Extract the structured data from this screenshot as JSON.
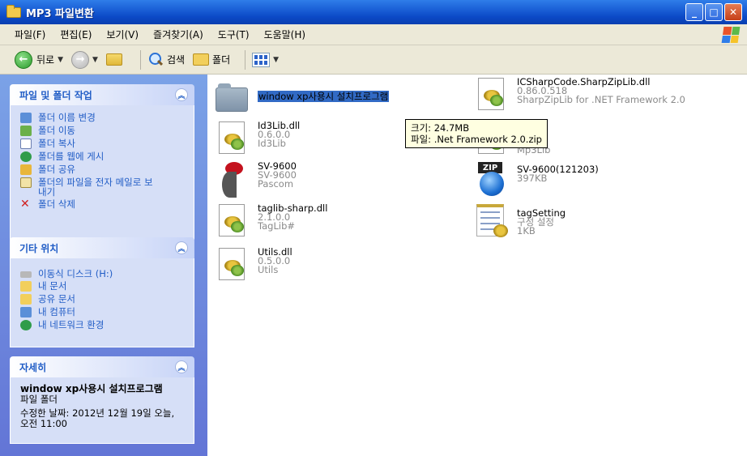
{
  "window": {
    "title": "MP3 파일변환"
  },
  "menu": [
    "파일(F)",
    "편집(E)",
    "보기(V)",
    "즐겨찾기(A)",
    "도구(T)",
    "도움말(H)"
  ],
  "toolbar": {
    "back_label": "뒤로",
    "search_label": "검색",
    "folders_label": "폴더"
  },
  "tasks": {
    "title": "파일 및 폴더 작업",
    "items": [
      "폴더 이름 변경",
      "폴더 이동",
      "폴더 복사",
      "폴더를 웹에 게시",
      "폴더 공유",
      "폴더의 파일을 전자 메일로 보내기",
      "폴더 삭제"
    ]
  },
  "places": {
    "title": "기타 위치",
    "items": [
      "이동식 디스크 (H:)",
      "내 문서",
      "공유 문서",
      "내 컴퓨터",
      "내 네트워크 환경"
    ]
  },
  "details": {
    "title": "자세히",
    "name": "window xp사용시 설치프로그램",
    "type": "파일 폴더",
    "modified": "수정한 날짜: 2012년 12월 19일 오늘, 오전 11:00"
  },
  "files": [
    {
      "name": "window xp사용시 설치프로그램",
      "lines": []
    },
    {
      "name": "ICSharpCode.SharpZipLib.dll",
      "lines": [
        "0.86.0.518",
        "SharpZipLib for .NET Framework 2.0"
      ]
    },
    {
      "name": "Id3Lib.dll",
      "lines": [
        "0.6.0.0",
        "Id3Lib"
      ]
    },
    {
      "name": "",
      "lines": [
        "Mp3Lib"
      ]
    },
    {
      "name": "SV-9600",
      "lines": [
        "SV-9600",
        "Pascom"
      ]
    },
    {
      "name": "SV-9600(121203)",
      "lines": [
        "397KB"
      ]
    },
    {
      "name": "taglib-sharp.dll",
      "lines": [
        "2.1.0.0",
        "TagLib#"
      ]
    },
    {
      "name": "tagSetting",
      "lines": [
        "구성 설정",
        "1KB"
      ]
    },
    {
      "name": "Utils.dll",
      "lines": [
        "0.5.0.0",
        "Utils"
      ]
    }
  ],
  "tooltip": {
    "line1": "크기: 24.7MB",
    "line2": "파일: .Net Framework 2.0.zip"
  }
}
